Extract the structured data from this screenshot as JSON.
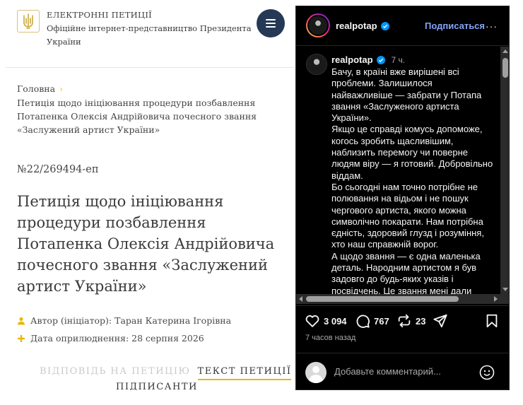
{
  "petition_site": {
    "header": {
      "title": "ЕЛЕКТРОННІ ПЕТИЦІЇ",
      "subtitle": "Офіційне інтернет-представництво Президента України",
      "emblem_icon": "trident-icon",
      "menu_icon": "hamburger-icon"
    },
    "breadcrumb": {
      "home": "Головна",
      "separator": "›",
      "current": "Петиція щодо ініціювання процедури позбавлення Потапенка Олексія Андрійовича почесного звання «Заслужений артист України»"
    },
    "petition_number": "№22/269494-еп",
    "title": "Петиція щодо ініціювання процедури позбавлення Потапенка Олексія Андрійовича почесного звання «Заслужений артист України»",
    "author": "Автор (ініціатор): Таран Катерина Ігорівна",
    "published": "Дата оприлюднення: 28 серпня 2026",
    "tabs": {
      "answer": "ВІДПОВІДЬ НА ПЕТИЦІЮ",
      "text": "ТЕКСТ ПЕТИЦІЇ",
      "signers": "ПІДПИСАНТИ"
    },
    "accent_color": "#e8b70c",
    "menu_color": "#253855"
  },
  "instagram": {
    "username": "realpotap",
    "follow_label": "Подписаться",
    "more_label": "···",
    "post": {
      "author": "realpotap",
      "time": "7 ч.",
      "paragraphs": [
        "Бачу, в країні вже вирішені всі проблеми. Залишилося найважливіше — забрати у Потапа звання «Заслуженого артиста України».",
        "Якщо це справді комусь допоможе, когось зробить щасливішим, наблизить перемогу чи поверне людям віру — я готовий. Добровільно віддам.",
        "Бо сьогодні нам точно потрібне не полювання на відьом і не пошук чергового артиста, якого можна символічно покарати. Нам потрібна єдність, здоровий глузд і розуміння, хто наш справжній ворог.",
        "А щодо звання — є одна маленька деталь. Народним артистом я був задовго до будь-яких указів і посвідчень. Це звання мені дали люди — концертами, піснями,"
      ]
    },
    "counts": {
      "likes": "3 094",
      "comments": "767",
      "reposts": "23"
    },
    "posted_ago": "7 часов назад",
    "comment_placeholder": "Добавьте комментарий...",
    "link_color": "#85a4f7",
    "verified_color": "#0095f6"
  }
}
